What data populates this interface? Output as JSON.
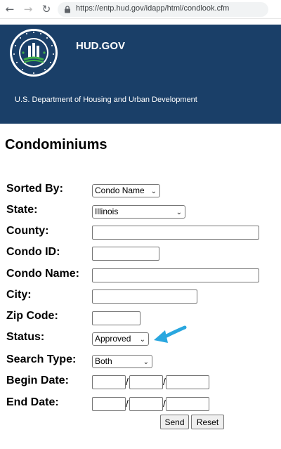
{
  "browser": {
    "url": "https://entp.hud.gov/idapp/html/condlook.cfm",
    "back_icon": "back-arrow-icon",
    "forward_icon": "forward-arrow-icon",
    "reload_icon": "reload-icon",
    "lock_icon": "lock-icon"
  },
  "header": {
    "site_name": "HUD.GOV",
    "subtitle": "U.S. Department of Housing and Urban Development",
    "bg_color": "#1a3f68"
  },
  "page": {
    "title": "Condominiums"
  },
  "form": {
    "sorted_by": {
      "label": "Sorted By:",
      "value": "Condo Name"
    },
    "state": {
      "label": "State:",
      "value": "Illinois"
    },
    "county": {
      "label": "County:",
      "value": ""
    },
    "condo_id": {
      "label": "Condo ID:",
      "value": ""
    },
    "condo_name": {
      "label": "Condo Name:",
      "value": ""
    },
    "city": {
      "label": "City:",
      "value": ""
    },
    "zip_code": {
      "label": "Zip Code:",
      "value": ""
    },
    "status": {
      "label": "Status:",
      "value": "Approved"
    },
    "search_type": {
      "label": "Search Type:",
      "value": "Both"
    },
    "begin_date": {
      "label": "Begin Date:",
      "separator": "/"
    },
    "end_date": {
      "label": "End Date:",
      "separator": "/"
    },
    "send_label": "Send",
    "reset_label": "Reset"
  },
  "annotation": {
    "arrow_color": "#2aa7df"
  }
}
